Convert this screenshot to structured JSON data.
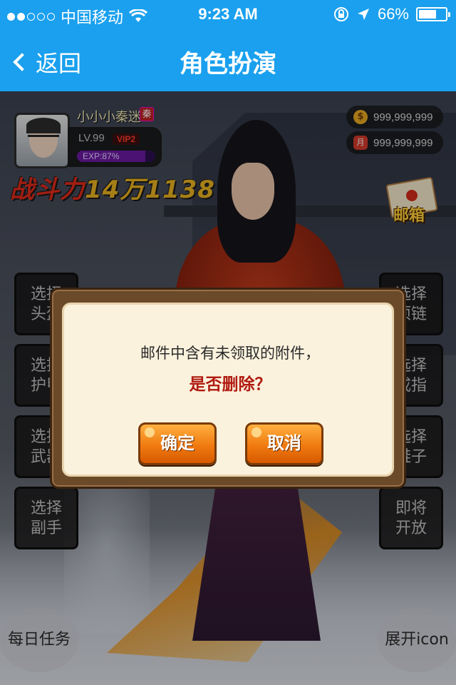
{
  "status_bar": {
    "carrier": "中国移动",
    "time": "9:23 AM",
    "battery_percent": "66%",
    "battery_level": 0.66,
    "signal_bars_filled": 2,
    "signal_bars_total": 5
  },
  "nav": {
    "back_label": "返回",
    "title": "角色扮演"
  },
  "player": {
    "name": "小小小秦迷",
    "realm": "秦",
    "level": "LV.99",
    "vip": "VIP2",
    "exp": "EXP:87%",
    "exp_fraction": 0.87,
    "power_label": "战斗力",
    "power_value": "14万1138"
  },
  "currency": {
    "gold": "999,999,999",
    "gem": "999,999,999",
    "gold_icon": "coin-icon",
    "gem_icon": "gem-icon"
  },
  "mailbox": {
    "label": "邮箱"
  },
  "left_buttons": [
    {
      "line1": "选择",
      "line2": "头盔"
    },
    {
      "line1": "选择",
      "line2": "护甲"
    },
    {
      "line1": "选择",
      "line2": "武器"
    },
    {
      "line1": "选择",
      "line2": "副手"
    }
  ],
  "right_buttons": [
    {
      "line1": "选择",
      "line2": "项链"
    },
    {
      "line1": "选择",
      "line2": "戒指"
    },
    {
      "line1": "选择",
      "line2": "鞋子"
    },
    {
      "line1": "即将",
      "line2": "开放"
    }
  ],
  "bottom": {
    "left_label": "每日任务",
    "right_label": "展开icon"
  },
  "dialog": {
    "message": "邮件中含有未领取的附件，",
    "question": "是否删除？",
    "confirm_label": "确定",
    "cancel_label": "取消"
  }
}
